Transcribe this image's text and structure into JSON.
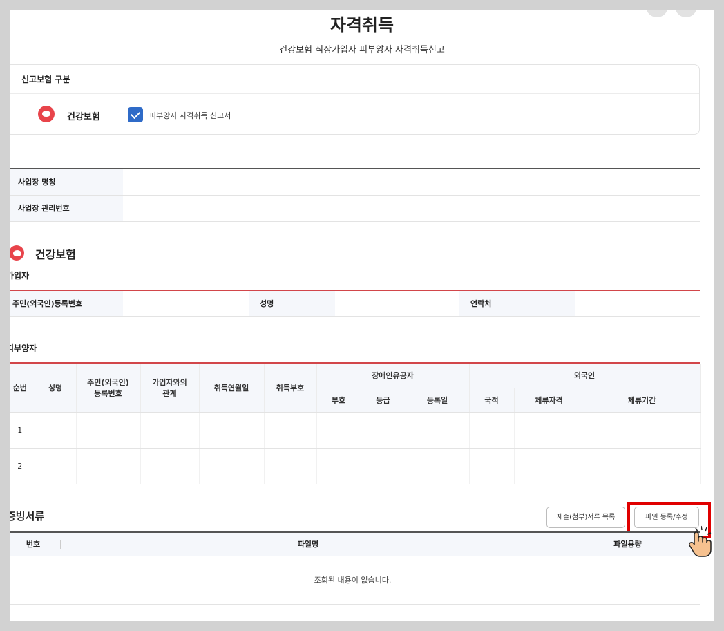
{
  "header": {
    "title": "자격취득",
    "subtitle": "건강보험 직장가입자 피부양자 자격취득신고"
  },
  "report_insurance": {
    "section_label": "신고보험 구분",
    "insurance_name": "건강보험",
    "checkbox_label": "피부양자 자격취득 신고서",
    "checkbox_checked": true
  },
  "workplace": {
    "name_label": "사업장 명칭",
    "name_value": "",
    "number_label": "사업장 관리번호",
    "number_value": ""
  },
  "health": {
    "section_title": "건강보험"
  },
  "subscriber": {
    "title": "가입자",
    "id_label": "주민(외국인)등록번호",
    "id_value": "",
    "name_label": "성명",
    "name_value": "",
    "contact_label": "연락처",
    "contact_value": ""
  },
  "dependents": {
    "title": "피부양자",
    "headers": {
      "seq": "순번",
      "name": "성명",
      "id_line1": "주민(외국인)",
      "id_line2": "등록번호",
      "rel_line1": "가입자와의",
      "rel_line2": "관계",
      "acq_date": "취득연월일",
      "acq_code": "취득부호",
      "disabled_group": "장애인유공자",
      "disabled_code": "부호",
      "disabled_grade": "등급",
      "disabled_reg_date": "등록일",
      "foreigner_group": "외국인",
      "nationality": "국적",
      "stay_status": "체류자격",
      "stay_period": "체류기간"
    },
    "rows": [
      {
        "seq": "1"
      },
      {
        "seq": "2"
      }
    ]
  },
  "evidence": {
    "title": "증빙서류",
    "list_button": "제출(첨부)서류 목록",
    "upload_button": "파일 등록/수정",
    "col_no": "번호",
    "col_filename": "파일명",
    "col_size": "파일용량",
    "empty_message": "조회된 내용이 없습니다."
  },
  "colors": {
    "accent_red": "#d2464a",
    "checkbox_blue": "#2f6bc8",
    "highlight_red": "#e00000"
  },
  "icons": [
    "heart-icon",
    "check-icon",
    "hand-cursor-icon"
  ]
}
